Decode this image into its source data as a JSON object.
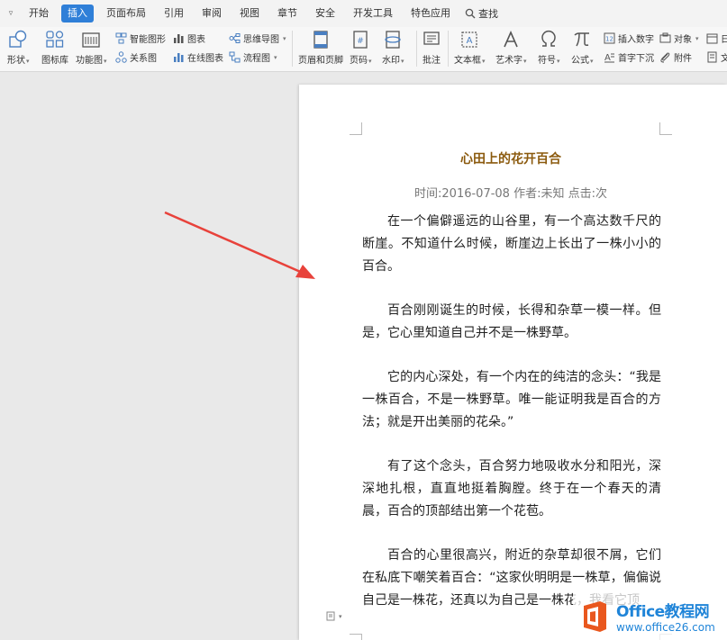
{
  "menu": {
    "items": [
      "开始",
      "插入",
      "页面布局",
      "引用",
      "审阅",
      "视图",
      "章节",
      "安全",
      "开发工具",
      "特色应用"
    ],
    "active_index": 1,
    "search_label": "查找"
  },
  "ribbon": {
    "shape": "形状",
    "icon_lib": "图标库",
    "func_chart": "功能图",
    "smart_art": "智能图形",
    "chart": "图表",
    "relation": "关系图",
    "online_chart": "在线图表",
    "mind_map": "思维导图",
    "flow_chart": "流程图",
    "header_footer": "页眉和页脚",
    "page_num": "页码",
    "watermark": "水印",
    "comment": "批注",
    "text_box": "文本框",
    "art_text": "艺术字",
    "symbol": "符号",
    "formula": "公式",
    "insert_number": "插入数字",
    "object": "对象",
    "drop_cap": "首字下沉",
    "attachment": "附件",
    "date_partial": "日",
    "text_partial": "文"
  },
  "document": {
    "title": "心田上的花开百合",
    "meta": "时间:2016-07-08  作者:未知  点击:次",
    "paragraphs": [
      "在一个偏僻遥远的山谷里，有一个高达数千尺的断崖。不知道什么时候，断崖边上长出了一株小小的百合。",
      "百合刚刚诞生的时候，长得和杂草一模一样。但是，它心里知道自己并不是一株野草。",
      "它的内心深处，有一个内在的纯洁的念头：“我是一株百合，不是一株野草。唯一能证明我是百合的方法；就是开出美丽的花朵。”",
      "有了这个念头，百合努力地吸收水分和阳光，深深地扎根，直直地挺着胸膛。终于在一个春天的清晨，百合的顶部结出第一个花苞。",
      "百合的心里很高兴，附近的杂草却很不屑，它们在私底下嘲笑着百合：“这家伙明明是一株草，偏偏说自己是一株花，还真以为自己是一株花，我看它顶"
    ]
  },
  "watermark_logo": {
    "brand": "Office教程网",
    "url": "www.office26.com"
  },
  "colors": {
    "accent": "#2f7fd8",
    "title": "#8b5a0e",
    "arrow": "#e8423b",
    "logo_orange": "#e9571e"
  }
}
